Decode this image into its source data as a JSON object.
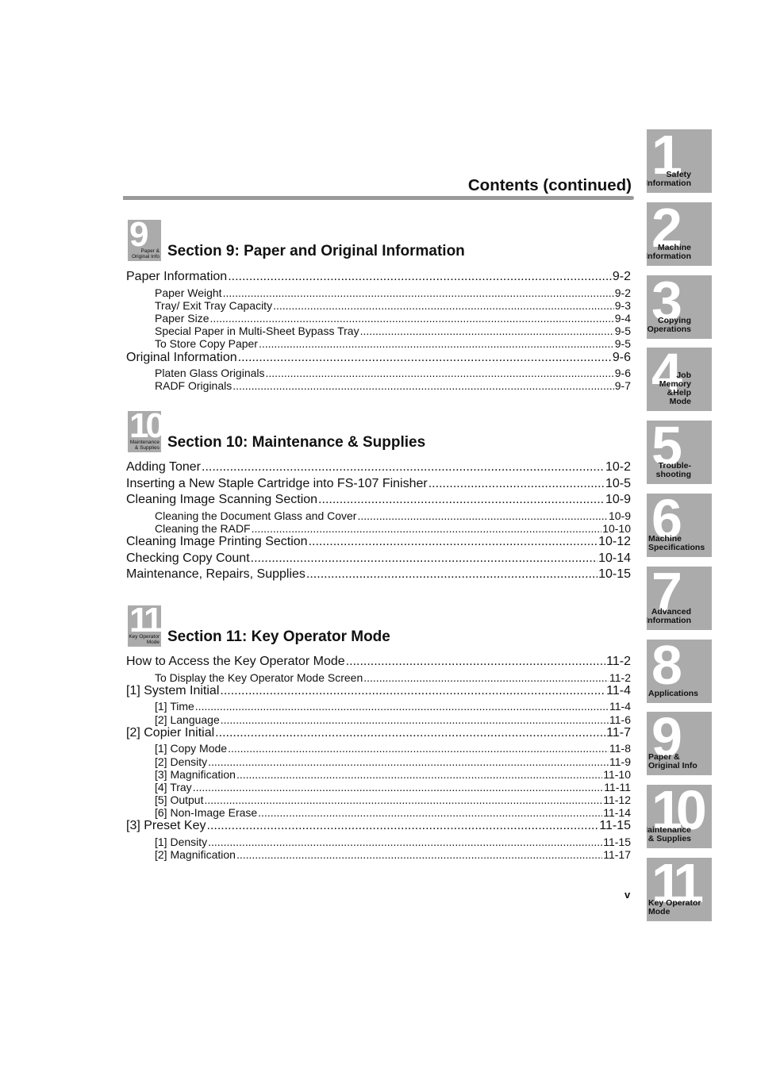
{
  "header": {
    "title": "Contents (continued)"
  },
  "sections": [
    {
      "badge_num": "9",
      "badge_label": [
        "Paper &",
        "Original Info"
      ],
      "title": "Section 9: Paper and Original Information",
      "entries": [
        {
          "level": 1,
          "text": "Paper Information",
          "page": "9-2"
        },
        {
          "level": 2,
          "text": "Paper Weight",
          "page": "9-2"
        },
        {
          "level": 2,
          "text": "Tray/ Exit Tray Capacity",
          "page": "9-3"
        },
        {
          "level": 2,
          "text": "Paper Size",
          "page": "9-4"
        },
        {
          "level": 2,
          "text": "Special Paper in Multi-Sheet Bypass Tray",
          "page": "9-5"
        },
        {
          "level": 2,
          "text": "To Store Copy Paper",
          "page": "9-5"
        },
        {
          "level": 1,
          "text": "Original Information",
          "page": "9-6"
        },
        {
          "level": 2,
          "text": "Platen Glass Originals",
          "page": "9-6"
        },
        {
          "level": 2,
          "text": "RADF Originals",
          "page": "9-7"
        }
      ]
    },
    {
      "badge_num": "10",
      "badge_label": [
        "Maintenance",
        "& Supplies"
      ],
      "title": "Section 10: Maintenance & Supplies",
      "entries": [
        {
          "level": 1,
          "text": "Adding Toner",
          "page": "10-2"
        },
        {
          "level": 1,
          "text": "Inserting a New Staple Cartridge into FS-107 Finisher",
          "page": "10-5"
        },
        {
          "level": 1,
          "text": "Cleaning Image Scanning Section",
          "page": "10-9"
        },
        {
          "level": 2,
          "text": "Cleaning the Document Glass and Cover",
          "page": "10-9"
        },
        {
          "level": 2,
          "text": "Cleaning the RADF",
          "page": "10-10"
        },
        {
          "level": 1,
          "text": "Cleaning Image Printing Section",
          "page": "10-12"
        },
        {
          "level": 1,
          "text": "Checking Copy Count",
          "page": "10-14"
        },
        {
          "level": 1,
          "text": "Maintenance, Repairs, Supplies",
          "page": "10-15"
        }
      ]
    },
    {
      "badge_num": "11",
      "badge_label": [
        "Key Operator",
        "Mode"
      ],
      "title": "Section 11: Key Operator Mode",
      "entries": [
        {
          "level": 1,
          "text": "How to Access the Key Operator Mode",
          "page": "11-2"
        },
        {
          "level": 2,
          "text": "To Display the Key Operator Mode Screen",
          "page": "11-2"
        },
        {
          "level": 1,
          "text": "[1] System Initial",
          "page": "11-4"
        },
        {
          "level": 2,
          "text": "[1] Time",
          "page": "11-4"
        },
        {
          "level": 2,
          "text": "[2] Language",
          "page": "11-6"
        },
        {
          "level": 1,
          "text": "[2] Copier Initial",
          "page": "11-7"
        },
        {
          "level": 2,
          "text": "[1] Copy Mode",
          "page": "11-8"
        },
        {
          "level": 2,
          "text": "[2] Density",
          "page": "11-9"
        },
        {
          "level": 2,
          "text": "[3] Magnification",
          "page": "11-10"
        },
        {
          "level": 2,
          "text": "[4] Tray",
          "page": "11-11"
        },
        {
          "level": 2,
          "text": "[5] Output",
          "page": "11-12"
        },
        {
          "level": 2,
          "text": "[6] Non-Image Erase",
          "page": "11-14"
        },
        {
          "level": 1,
          "text": "[3] Preset Key",
          "page": "11-15"
        },
        {
          "level": 2,
          "text": "[1] Density",
          "page": "11-15"
        },
        {
          "level": 2,
          "text": "[2] Magnification",
          "page": "11-17"
        }
      ]
    }
  ],
  "page_number": "v",
  "side_tabs": [
    {
      "num": "1",
      "label": [
        "Safety",
        "Information"
      ]
    },
    {
      "num": "2",
      "label": [
        "Machine",
        "Information"
      ]
    },
    {
      "num": "3",
      "label": [
        "Copying",
        "Operations"
      ]
    },
    {
      "num": "4",
      "label": [
        "Job Memory",
        "&Help Mode"
      ]
    },
    {
      "num": "5",
      "label": [
        "Trouble-",
        "shooting"
      ]
    },
    {
      "num": "6",
      "label": [
        "Machine",
        "Specifications"
      ]
    },
    {
      "num": "7",
      "label": [
        "Advanced",
        "Information"
      ]
    },
    {
      "num": "8",
      "label": [
        "Applications"
      ]
    },
    {
      "num": "9",
      "label": [
        "Paper &",
        "Original Info"
      ]
    },
    {
      "num": "10",
      "label": [
        "Maintenance",
        "& Supplies"
      ]
    },
    {
      "num": "11",
      "label": [
        "Key Operator",
        "Mode"
      ]
    }
  ],
  "colors": {
    "tab_bg": "#ababab",
    "rule": "#9a9a9a"
  }
}
